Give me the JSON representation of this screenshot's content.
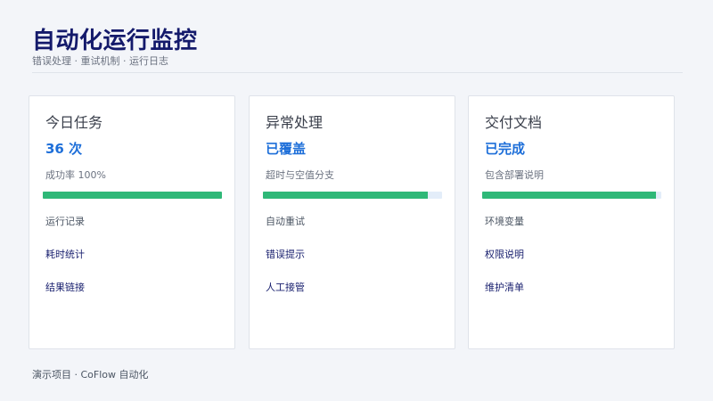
{
  "header": {
    "title": "自动化运行监控",
    "subtitle": "错误处理 · 重试机制 · 运行日志"
  },
  "cards": [
    {
      "title": "今日任务",
      "value": "36 次",
      "desc": "成功率 100%",
      "progress": 1.0,
      "note": "运行记录",
      "links": [
        "耗时统计",
        "结果链接"
      ]
    },
    {
      "title": "异常处理",
      "value": "已覆盖",
      "desc": "超时与空值分支",
      "progress": 0.92,
      "note": "自动重试",
      "links": [
        "错误提示",
        "人工接管"
      ]
    },
    {
      "title": "交付文档",
      "value": "已完成",
      "desc": "包含部署说明",
      "progress": 0.97,
      "note": "环境变量",
      "links": [
        "权限说明",
        "维护清单"
      ]
    }
  ],
  "footer": {
    "text": "演示项目 · CoFlow 自动化"
  },
  "colors": {
    "title": "#141a6b",
    "accent_value": "#1e6fd9",
    "progress_fill": "#2fb878",
    "progress_track": "#e3edf9",
    "background": "#f3f5f9"
  }
}
